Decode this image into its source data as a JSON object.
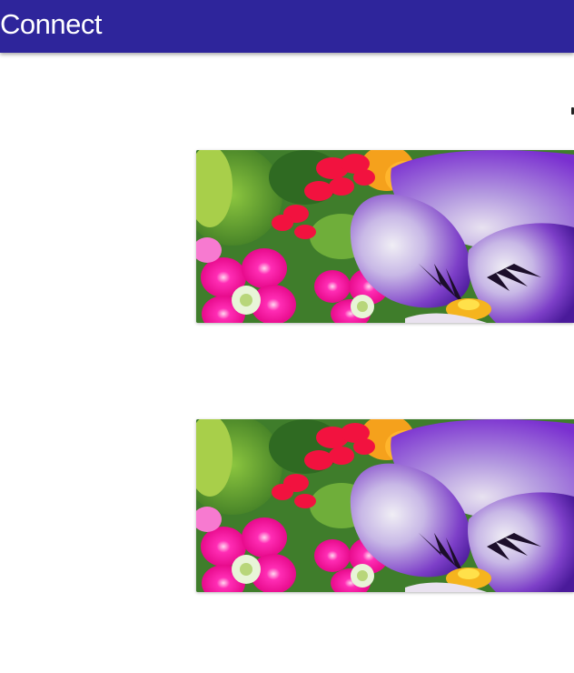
{
  "app_bar": {
    "title": "Connect",
    "color": "#2e259b"
  },
  "cards": [
    {
      "image_subject": "flower-photo"
    },
    {
      "image_subject": "flower-photo"
    }
  ]
}
